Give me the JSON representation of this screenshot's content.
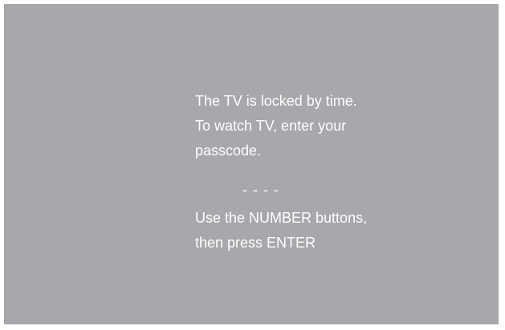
{
  "lock_screen": {
    "message_lines": [
      "The TV is locked by time.",
      "To watch TV, enter your",
      "passcode."
    ],
    "passcode_display": "- - - -",
    "instruction_lines": [
      "Use the NUMBER buttons,",
      "then press ENTER"
    ]
  },
  "colors": {
    "background": "#a7a8ab",
    "text": "#ffffff"
  }
}
